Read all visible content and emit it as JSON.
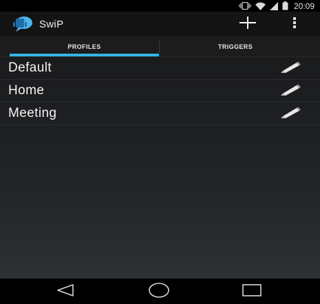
{
  "status_bar": {
    "time": "20:09",
    "icons": [
      "vibrate-icon",
      "wifi-icon",
      "signal-icon",
      "battery-icon"
    ]
  },
  "app_bar": {
    "title": "SwiP",
    "logo_icon": "android-chat-bubble-logo",
    "actions": [
      "add-icon",
      "overflow-menu-icon"
    ]
  },
  "tabs": [
    {
      "label": "PROFILES",
      "selected": true
    },
    {
      "label": "TRIGGERS",
      "selected": false
    }
  ],
  "profiles": [
    {
      "name": "Default",
      "action_icon": "pencil-icon"
    },
    {
      "name": "Home",
      "action_icon": "pencil-icon"
    },
    {
      "name": "Meeting",
      "action_icon": "pencil-icon"
    }
  ],
  "nav_bar": {
    "buttons": [
      "back-icon",
      "home-icon",
      "recents-icon"
    ]
  },
  "colors": {
    "accent": "#33b5e5",
    "action_bar": "#141414",
    "tab_bar": "#1c1c1c",
    "background": "#222427"
  }
}
